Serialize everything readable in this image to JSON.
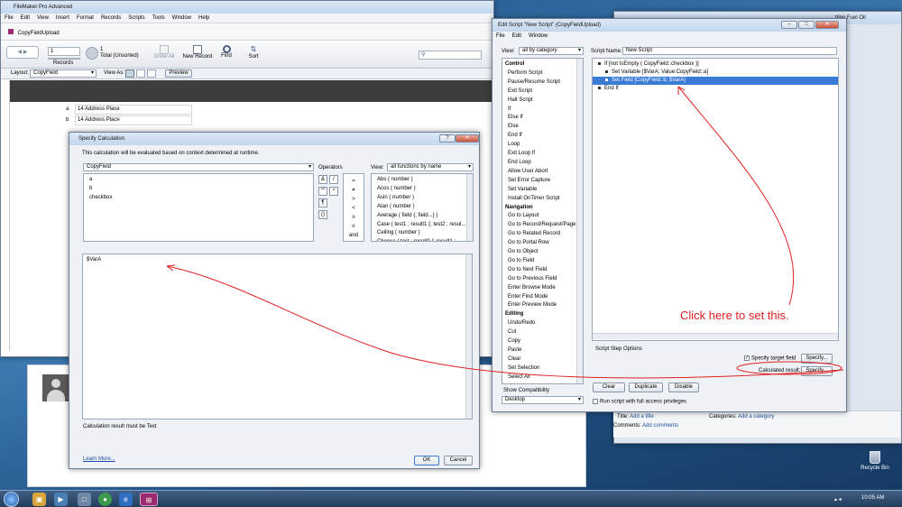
{
  "fm_window": {
    "title": "FileMaker Pro Advanced",
    "menus": [
      "File",
      "Edit",
      "View",
      "Insert",
      "Format",
      "Records",
      "Scripts",
      "Tools",
      "Window",
      "Help"
    ],
    "tab": "CopyFieldUpload",
    "record_value": "1",
    "records_label": "Records",
    "total_count": "1",
    "total_label": "Total (Unsorted)",
    "show_all": "Show All",
    "new_record": "New Record",
    "find": "Find",
    "sort": "Sort",
    "layout_label": "Layout:",
    "layout_value": "CopyField",
    "view_as": "View As:",
    "preview": "Preview",
    "rows": [
      {
        "field": "a",
        "value": "14 Address Place"
      },
      {
        "field": "b",
        "value": "14 Address Place"
      }
    ]
  },
  "calc_dialog": {
    "title": "Specify Calculation",
    "help": "?",
    "close": "✕",
    "context_note": "This calculation will be evaluated based on context determined at runtime.",
    "table_select": "CopyField",
    "fields": [
      "a",
      "b",
      "checkbox"
    ],
    "operators_label": "Operators",
    "operators": [
      [
        "&",
        "/"
      ],
      [
        "\"\"",
        "^"
      ],
      [
        "¶",
        ""
      ],
      [
        "()",
        ""
      ]
    ],
    "compare_ops": [
      "=",
      "≠",
      ">",
      "<",
      "≥",
      "≤",
      "and"
    ],
    "view_label": "View:",
    "view_select": "all functions by name",
    "functions": [
      "Abs ( number )",
      "Acos ( number )",
      "Asin ( number )",
      "Atan ( number )",
      "Average ( field {; field...} )",
      "Case ( test1 ; result1 {; test2 ; resul...",
      "Ceiling ( number )",
      "Choose ( test ; result0 {; result1 ; ..."
    ],
    "formula": "$VarA",
    "result_note": "Calculation result must be Text",
    "learn_more": "Learn More...",
    "ok": "OK",
    "cancel": "Cancel"
  },
  "script_window": {
    "title": "Edit Script \"New Script\" (CopyFieldUpload)",
    "menus": [
      "File",
      "Edit",
      "Window"
    ],
    "view_label": "View:",
    "view_select": "all by category",
    "script_name_label": "Script Name:",
    "script_name": "New Script",
    "categories": [
      {
        "label": "Control",
        "header": true
      },
      {
        "label": "Perform Script"
      },
      {
        "label": "Pause/Resume Script"
      },
      {
        "label": "Exit Script"
      },
      {
        "label": "Halt Script"
      },
      {
        "label": "If"
      },
      {
        "label": "Else If"
      },
      {
        "label": "Else"
      },
      {
        "label": "End If"
      },
      {
        "label": "Loop"
      },
      {
        "label": "Exit Loop If"
      },
      {
        "label": "End Loop"
      },
      {
        "label": "Allow User Abort"
      },
      {
        "label": "Set Error Capture"
      },
      {
        "label": "Set Variable"
      },
      {
        "label": "Install OnTimer Script"
      },
      {
        "label": "Navigation",
        "header": true
      },
      {
        "label": "Go to Layout"
      },
      {
        "label": "Go to Record/Request/Page"
      },
      {
        "label": "Go to Related Record"
      },
      {
        "label": "Go to Portal Row"
      },
      {
        "label": "Go to Object"
      },
      {
        "label": "Go to Field"
      },
      {
        "label": "Go to Next Field"
      },
      {
        "label": "Go to Previous Field"
      },
      {
        "label": "Enter Browse Mode"
      },
      {
        "label": "Enter Find Mode"
      },
      {
        "label": "Enter Preview Mode"
      },
      {
        "label": "Editing",
        "header": true
      },
      {
        "label": "Undo/Redo"
      },
      {
        "label": "Cut"
      },
      {
        "label": "Copy"
      },
      {
        "label": "Paste"
      },
      {
        "label": "Clear"
      },
      {
        "label": "Set Selection"
      },
      {
        "label": "Select All"
      }
    ],
    "show_compat": "Show Compatibility",
    "compat_select": "Desktop",
    "steps": [
      {
        "text": "If [not IsEmpty ( CopyField::checkbox )]",
        "indent": 0,
        "selected": false
      },
      {
        "text": "Set Variable [$VarA; Value:CopyField::a]",
        "indent": 1,
        "selected": false
      },
      {
        "text": "Set Field [CopyField::b; $VarA]",
        "indent": 1,
        "selected": true
      },
      {
        "text": "End If",
        "indent": 0,
        "selected": false
      }
    ],
    "options_label": "Script Step Options",
    "specify_target": "Specify target field",
    "calc_result": "Calculated result:",
    "specify": "Specify...",
    "clear": "Clear",
    "duplicate": "Duplicate",
    "disable": "Disable",
    "full_access": "Run script with full access privileges"
  },
  "annotation": {
    "text": "Click here to set this.",
    "color": "#e02020"
  },
  "blog": {
    "title_label": "Title:",
    "title_value": "Add a title",
    "categories_label": "Categories:",
    "categories_value": "Add a category",
    "comments_label": "Comments:",
    "comments_value": "Add comments"
  },
  "far_right_title": "ttino Fuel Oil",
  "desktop": {
    "recycle_bin": "Recycle Bin"
  },
  "taskbar": {
    "clock": "10:05 AM"
  }
}
